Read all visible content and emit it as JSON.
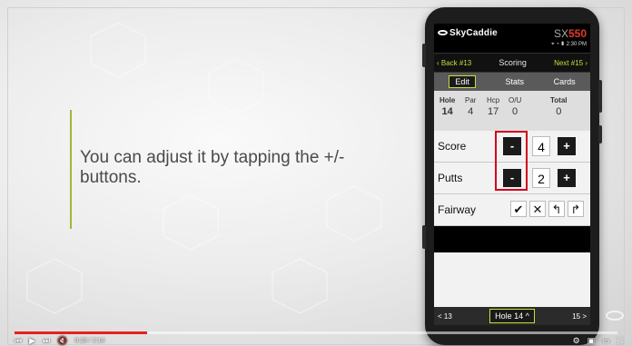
{
  "caption": "You can adjust it by tapping the +/- buttons.",
  "device": {
    "brand": "SkyCaddie",
    "model_prefix": "SX",
    "model_number": "550",
    "status_time": "2:30 PM"
  },
  "nav": {
    "back": "Back #13",
    "title": "Scoring",
    "next": "Next #15"
  },
  "tabs": [
    "Edit",
    "Stats",
    "Cards"
  ],
  "hole_info": {
    "hole_label": "Hole",
    "hole_value": "14",
    "par_label": "Par",
    "par_value": "4",
    "hcp_label": "Hcp",
    "hcp_value": "17",
    "ou_label": "O/U",
    "ou_value": "0",
    "total_label": "Total",
    "total_value": "0"
  },
  "score": {
    "label": "Score",
    "minus": "-",
    "value": "4",
    "plus": "+"
  },
  "putts": {
    "label": "Putts",
    "minus": "-",
    "value": "2",
    "plus": "+"
  },
  "fairway": {
    "label": "Fairway",
    "hit": "✔",
    "miss": "✕",
    "left": "↰",
    "right": "↱"
  },
  "bottom": {
    "prev": "< 13",
    "current": "Hole 14 ^",
    "next": "15 >"
  },
  "video": {
    "time": "0:28 / 2:14",
    "progress": 0.22
  },
  "colors": {
    "accent": "#cddc39",
    "highlight": "#d0021b",
    "progress": "#e6211e"
  }
}
